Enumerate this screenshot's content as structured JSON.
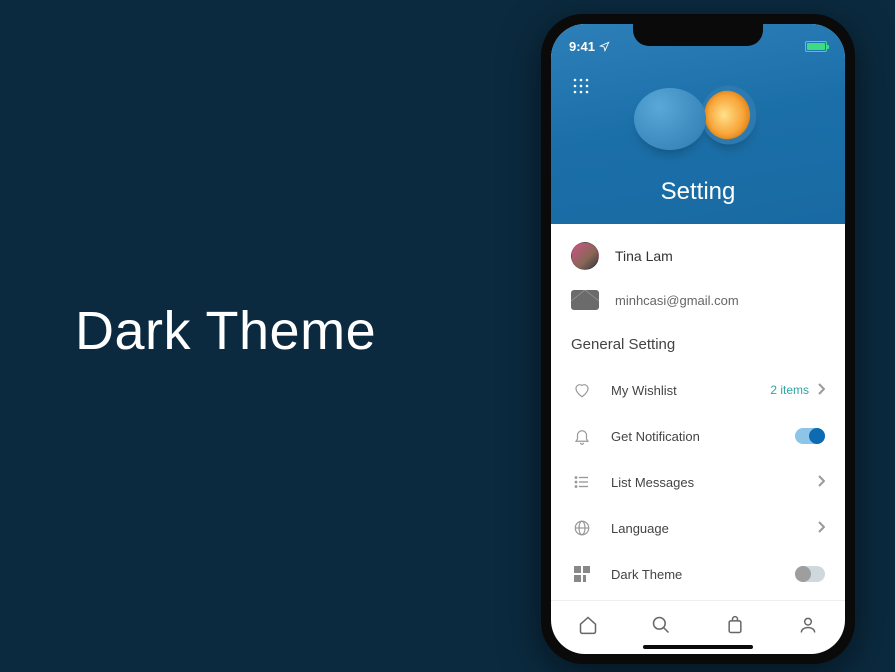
{
  "page_title": "Dark Theme",
  "status": {
    "time": "9:41"
  },
  "header": {
    "title": "Setting"
  },
  "user": {
    "name": "Tina Lam",
    "email": "minhcasi@gmail.com"
  },
  "section": {
    "title": "General Setting"
  },
  "settings": {
    "wishlist": {
      "label": "My Wishlist",
      "count_text": "2 items"
    },
    "notification": {
      "label": "Get Notification",
      "on": true
    },
    "messages": {
      "label": "List Messages"
    },
    "language": {
      "label": "Language"
    },
    "dark_theme": {
      "label": "Dark Theme",
      "on": false
    }
  }
}
